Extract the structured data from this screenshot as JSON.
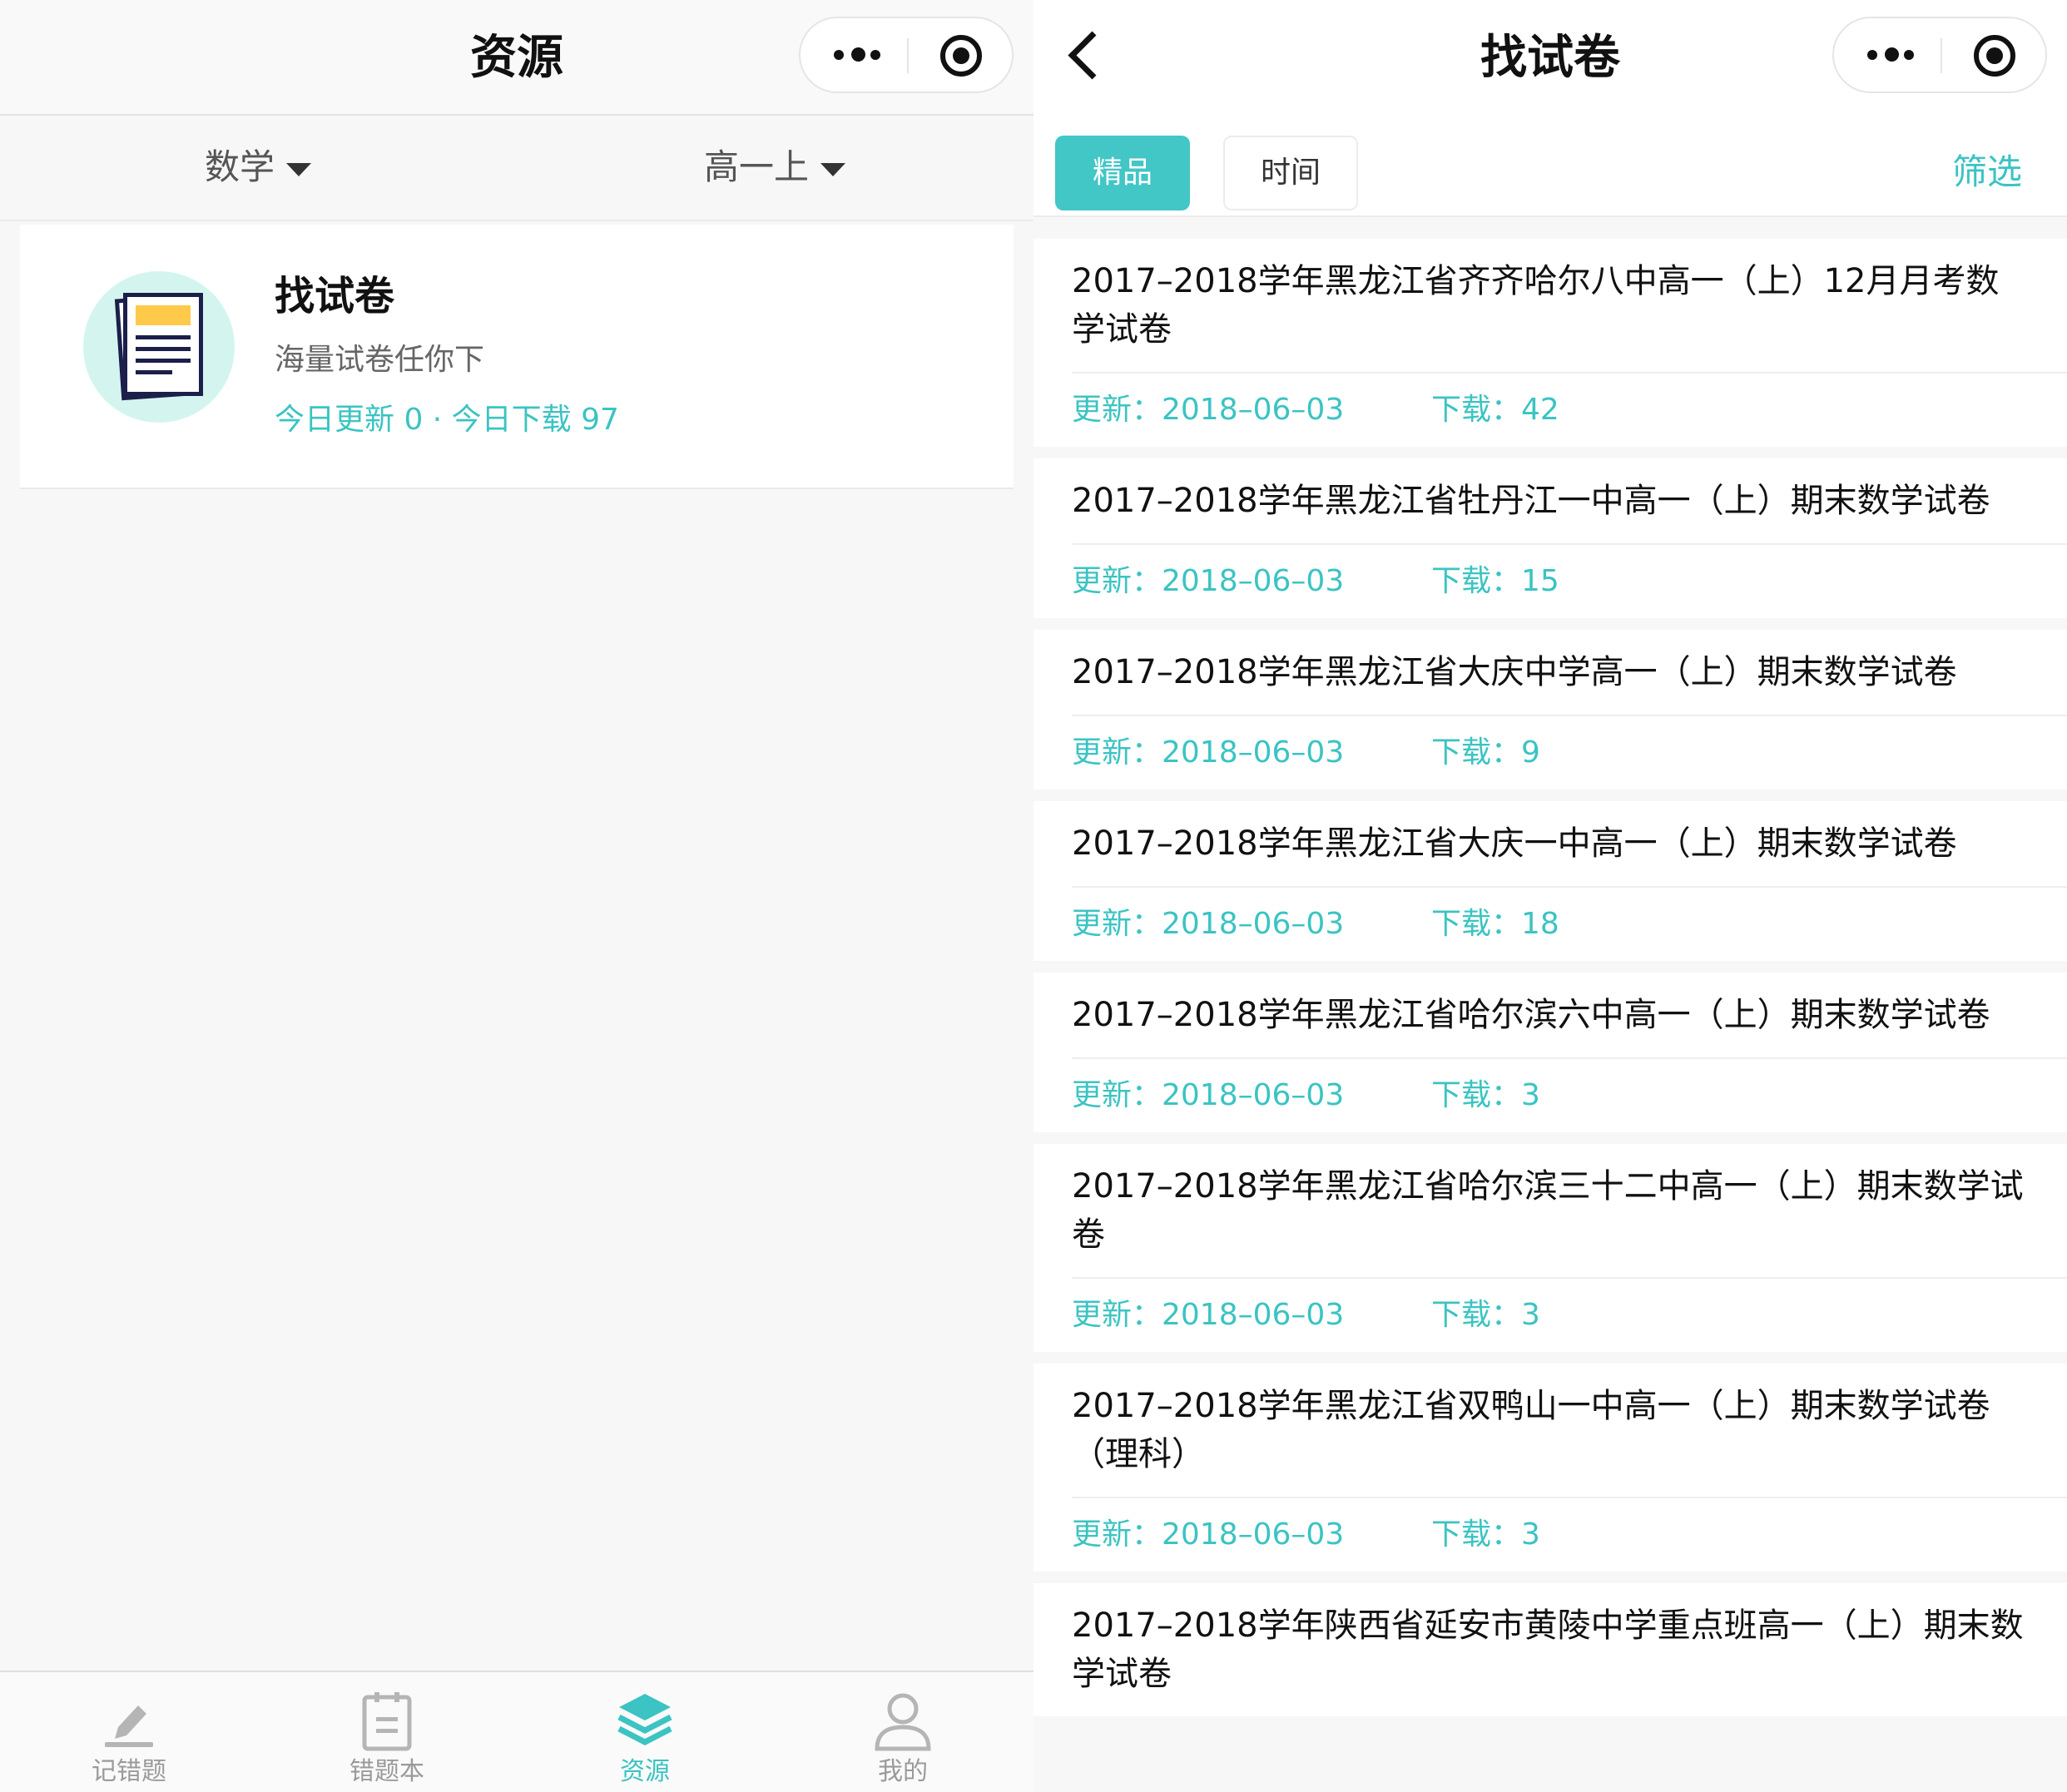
{
  "left": {
    "nav": {
      "title": "资源"
    },
    "filters": {
      "subject": "数学",
      "grade": "高一上"
    },
    "card": {
      "title": "找试卷",
      "subtitle": "海量试卷任你下",
      "stats": "今日更新 0 · 今日下载 97"
    },
    "tabbar": [
      {
        "label": "记错题",
        "icon": "pencil-edit-icon",
        "active": false
      },
      {
        "label": "错题本",
        "icon": "notebook-icon",
        "active": false
      },
      {
        "label": "资源",
        "icon": "layers-stack-icon",
        "active": true
      },
      {
        "label": "我的",
        "icon": "user-profile-icon",
        "active": false
      }
    ]
  },
  "right": {
    "nav": {
      "title": "找试卷"
    },
    "tabs": {
      "featured": "精品",
      "time": "时间",
      "filter": "筛选"
    },
    "papers": [
      {
        "title": "2017–2018学年黑龙江省齐齐哈尔八中高一（上）12月月考数学试卷",
        "updated": "更新：2018–06–03",
        "downloads": "下载：42"
      },
      {
        "title": "2017–2018学年黑龙江省牡丹江一中高一（上）期末数学试卷",
        "updated": "更新：2018–06–03",
        "downloads": "下载：15"
      },
      {
        "title": "2017–2018学年黑龙江省大庆中学高一（上）期末数学试卷",
        "updated": "更新：2018–06–03",
        "downloads": "下载：9"
      },
      {
        "title": "2017–2018学年黑龙江省大庆一中高一（上）期末数学试卷",
        "updated": "更新：2018–06–03",
        "downloads": "下载：18"
      },
      {
        "title": "2017–2018学年黑龙江省哈尔滨六中高一（上）期末数学试卷",
        "updated": "更新：2018–06–03",
        "downloads": "下载：3"
      },
      {
        "title": "2017–2018学年黑龙江省哈尔滨三十二中高一（上）期末数学试卷",
        "updated": "更新：2018–06–03",
        "downloads": "下载：3"
      },
      {
        "title": "2017–2018学年黑龙江省双鸭山一中高一（上）期末数学试卷（理科）",
        "updated": "更新：2018–06–03",
        "downloads": "下载：3"
      },
      {
        "title": "2017–2018学年陕西省延安市黄陵中学重点班高一（上）期末数学试卷",
        "updated": "",
        "downloads": ""
      }
    ]
  },
  "colors": {
    "accent": "#3cc3c3",
    "chip": "#42c6c6",
    "doc_header": "#ffc94a",
    "icon_bg": "#d4f5ef"
  }
}
